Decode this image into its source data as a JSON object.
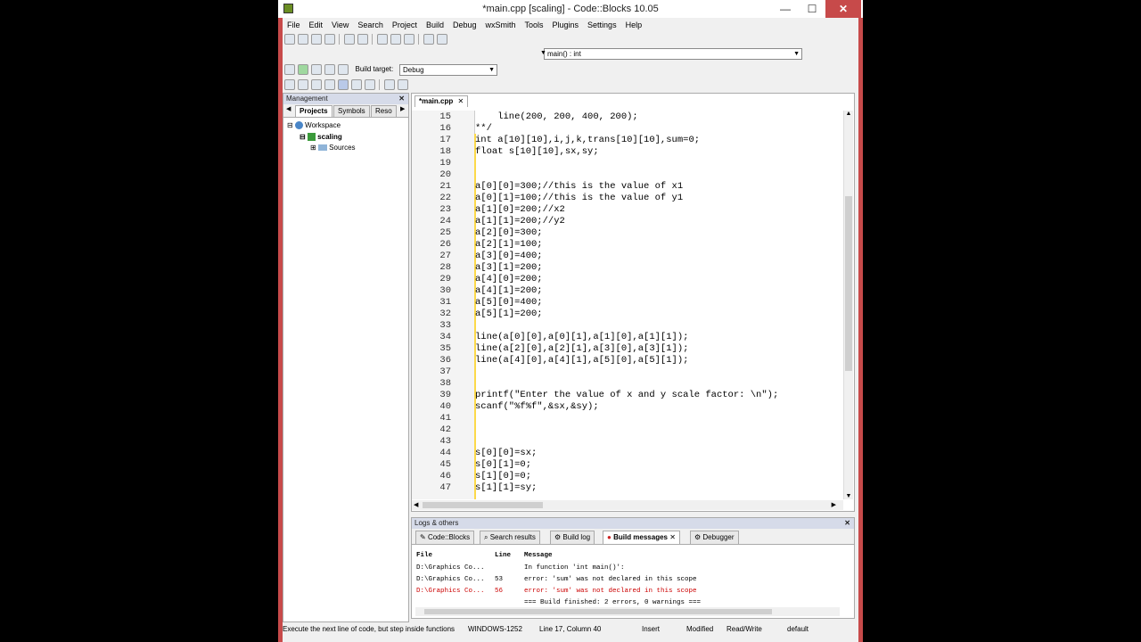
{
  "window": {
    "title": "*main.cpp [scaling] - Code::Blocks 10.05",
    "minimize": "—",
    "maximize": "☐",
    "close": "✕"
  },
  "menu": [
    "File",
    "Edit",
    "View",
    "Search",
    "Project",
    "Build",
    "Debug",
    "wxSmith",
    "Tools",
    "Plugins",
    "Settings",
    "Help"
  ],
  "func_combo": "main() : int",
  "build_target_label": "Build target:",
  "build_target_value": "Debug",
  "management": {
    "title": "Management",
    "close": "✕",
    "tabs": [
      "Projects",
      "Symbols",
      "Reso"
    ],
    "tree": {
      "workspace": "Workspace",
      "project": "scaling",
      "folder": "Sources"
    }
  },
  "editor": {
    "tab": "*main.cpp",
    "tab_close": "✕",
    "lines": [
      {
        "n": "15",
        "t": "    line(200, 200, 400, 200);"
      },
      {
        "n": "16",
        "t": "**/"
      },
      {
        "n": "17",
        "t": "int a[10][10],i,j,k,trans[10][10],sum=0;"
      },
      {
        "n": "18",
        "t": "float s[10][10],sx,sy;"
      },
      {
        "n": "19",
        "t": ""
      },
      {
        "n": "20",
        "t": ""
      },
      {
        "n": "21",
        "t": "a[0][0]=300;//this is the value of x1"
      },
      {
        "n": "22",
        "t": "a[0][1]=100;//this is the value of y1"
      },
      {
        "n": "23",
        "t": "a[1][0]=200;//x2"
      },
      {
        "n": "24",
        "t": "a[1][1]=200;//y2"
      },
      {
        "n": "25",
        "t": "a[2][0]=300;"
      },
      {
        "n": "26",
        "t": "a[2][1]=100;"
      },
      {
        "n": "27",
        "t": "a[3][0]=400;"
      },
      {
        "n": "28",
        "t": "a[3][1]=200;"
      },
      {
        "n": "29",
        "t": "a[4][0]=200;"
      },
      {
        "n": "30",
        "t": "a[4][1]=200;"
      },
      {
        "n": "31",
        "t": "a[5][0]=400;"
      },
      {
        "n": "32",
        "t": "a[5][1]=200;"
      },
      {
        "n": "33",
        "t": ""
      },
      {
        "n": "34",
        "t": "line(a[0][0],a[0][1],a[1][0],a[1][1]);"
      },
      {
        "n": "35",
        "t": "line(a[2][0],a[2][1],a[3][0],a[3][1]);"
      },
      {
        "n": "36",
        "t": "line(a[4][0],a[4][1],a[5][0],a[5][1]);"
      },
      {
        "n": "37",
        "t": ""
      },
      {
        "n": "38",
        "t": ""
      },
      {
        "n": "39",
        "t": "printf(\"Enter the value of x and y scale factor: \\n\");"
      },
      {
        "n": "40",
        "t": "scanf(\"%f%f\",&sx,&sy);"
      },
      {
        "n": "41",
        "t": ""
      },
      {
        "n": "42",
        "t": ""
      },
      {
        "n": "43",
        "t": ""
      },
      {
        "n": "44",
        "t": "s[0][0]=sx;"
      },
      {
        "n": "45",
        "t": "s[0][1]=0;"
      },
      {
        "n": "46",
        "t": "s[1][0]=0;"
      },
      {
        "n": "47",
        "t": "s[1][1]=sy;"
      }
    ]
  },
  "logs": {
    "title": "Logs & others",
    "close": "✕",
    "tabs": [
      "Code::Blocks",
      "Search results",
      "Build log",
      "Build messages",
      "Debugger"
    ],
    "tab_close": "✕",
    "columns": [
      "File",
      "Line",
      "Message"
    ],
    "rows": [
      {
        "file": "D:\\Graphics Co...",
        "line": "",
        "msg": "In function 'int main()':",
        "color": "#000000"
      },
      {
        "file": "D:\\Graphics Co...",
        "line": "53",
        "msg": "error: 'sum' was not declared in this scope",
        "color": "#000000"
      },
      {
        "file": "D:\\Graphics Co...",
        "line": "56",
        "msg": "error: 'sum' was not declared in this scope",
        "color": "#cc0000"
      },
      {
        "file": "",
        "line": "",
        "msg": "=== Build finished: 2 errors, 0 warnings ===",
        "color": "#000000"
      }
    ]
  },
  "status": {
    "hint": "Execute the next line of code, but step inside functions",
    "encoding": "WINDOWS-1252",
    "position": "Line 17, Column 40",
    "mode": "Insert",
    "modified": "Modified",
    "access": "Read/Write",
    "profile": "default"
  }
}
